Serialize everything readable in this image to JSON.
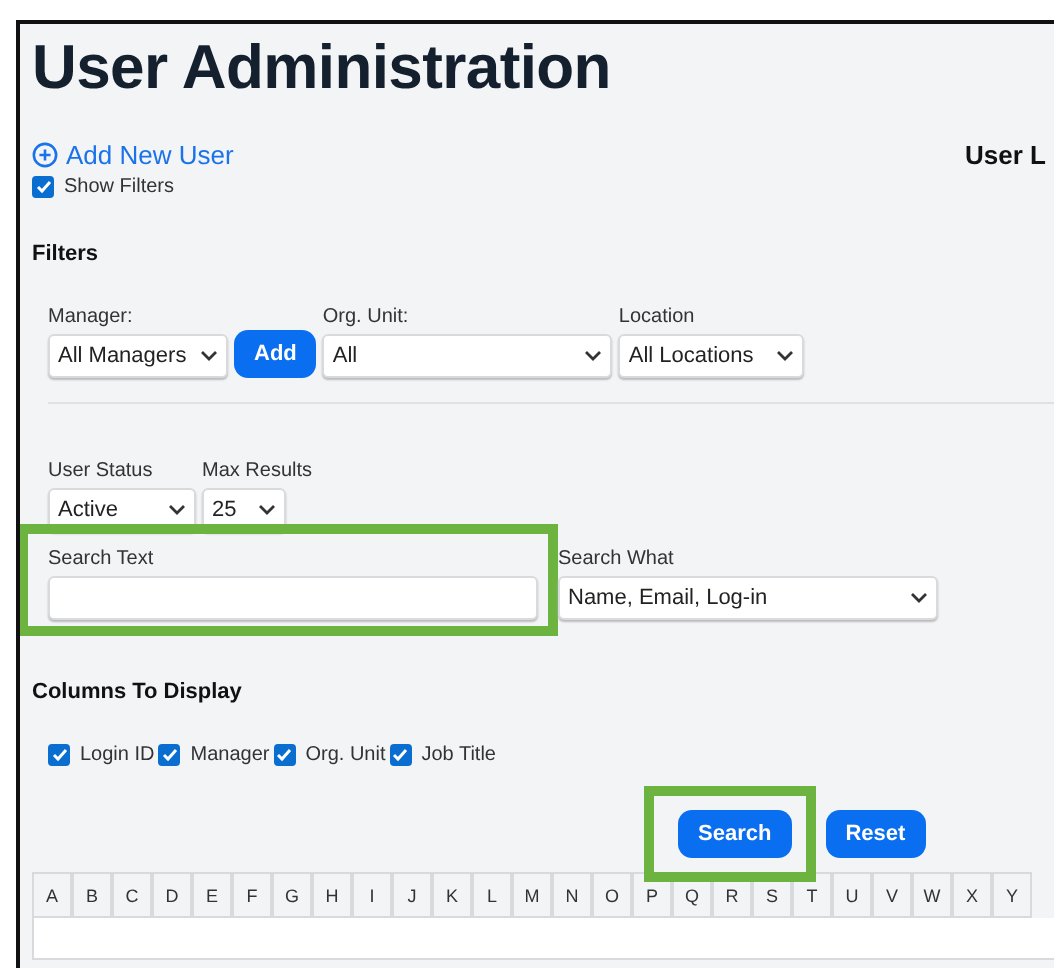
{
  "title": "User Administration",
  "add_user_link": "Add New User",
  "side_heading": "User L",
  "show_filters": {
    "label": "Show Filters",
    "checked": true
  },
  "filters": {
    "heading": "Filters",
    "manager": {
      "label": "Manager:",
      "value": "All Managers",
      "button": "Add"
    },
    "org_unit": {
      "label": "Org. Unit:",
      "value": "All"
    },
    "location": {
      "label": "Location",
      "value": "All Locations"
    },
    "user_status": {
      "label": "User Status",
      "value": "Active"
    },
    "max_results": {
      "label": "Max Results",
      "value": "25"
    },
    "search_text": {
      "label": "Search Text",
      "highlighted": true
    },
    "search_what": {
      "label": "Search What",
      "value": "Name, Email, Log-in"
    }
  },
  "columns_to_display": {
    "heading": "Columns To Display",
    "options": [
      {
        "label": "Login ID",
        "checked": true
      },
      {
        "label": "Manager",
        "checked": true
      },
      {
        "label": "Org. Unit",
        "checked": true
      },
      {
        "label": "Job Title",
        "checked": true
      }
    ]
  },
  "buttons": [
    {
      "label": "Search",
      "highlighted": true
    },
    {
      "label": "Reset",
      "highlighted": false
    }
  ],
  "letters": [
    "A",
    "B",
    "C",
    "D",
    "E",
    "F",
    "G",
    "H",
    "I",
    "J",
    "K",
    "L",
    "M",
    "N",
    "O",
    "P",
    "Q",
    "R",
    "S",
    "T",
    "U",
    "V",
    "W",
    "X",
    "Y"
  ]
}
